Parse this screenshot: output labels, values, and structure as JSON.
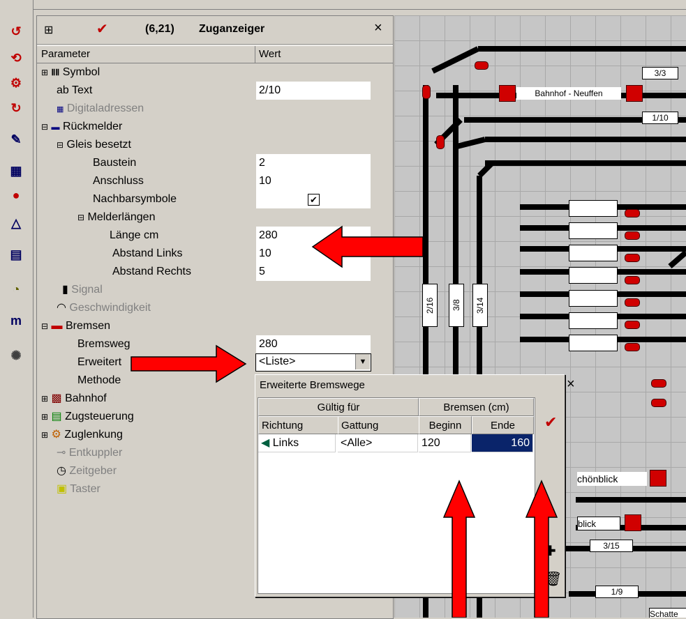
{
  "panel": {
    "coord": "(6,21)",
    "title": "Zuganzeiger",
    "close": "×",
    "col_param": "Parameter",
    "col_value": "Wert",
    "rows": [
      {
        "label": "Symbol"
      },
      {
        "label": "Text",
        "prefix": "ab",
        "value": "2/10"
      },
      {
        "label": "Digitaladressen"
      },
      {
        "label": "Rückmelder"
      },
      {
        "label": "Gleis besetzt"
      },
      {
        "label": "Baustein",
        "value": "2"
      },
      {
        "label": "Anschluss",
        "value": "10"
      },
      {
        "label": "Nachbarsymbole",
        "checked": true
      },
      {
        "label": "Melderlängen"
      },
      {
        "label": "Länge cm",
        "value": "280"
      },
      {
        "label": "Abstand Links",
        "value": "10"
      },
      {
        "label": "Abstand Rechts",
        "value": "5"
      },
      {
        "label": "Signal"
      },
      {
        "label": "Geschwindigkeit"
      },
      {
        "label": "Bremsen"
      },
      {
        "label": "Bremsweg",
        "value": "280"
      },
      {
        "label": "Erweitert",
        "value": "<Liste>"
      },
      {
        "label": "Methode"
      },
      {
        "label": "Bahnhof"
      },
      {
        "label": "Zugsteuerung"
      },
      {
        "label": "Zuglenkung"
      },
      {
        "label": "Entkuppler"
      },
      {
        "label": "Zeitgeber"
      },
      {
        "label": "Taster"
      }
    ]
  },
  "dialog": {
    "title": "Erweiterte Bremswege",
    "close": "×",
    "group1": "Gültig für",
    "group2": "Bremsen (cm)",
    "col_richtung": "Richtung",
    "col_gattung": "Gattung",
    "col_beginn": "Beginn",
    "col_ende": "Ende",
    "row": {
      "richtung": "Links",
      "gattung": "<Alle>",
      "beginn": "120",
      "ende": "160"
    }
  },
  "track": {
    "labels": [
      "3/3",
      "Bahnhof - Neuffen",
      "1/10",
      "2/16",
      "3/8",
      "3/14",
      "chönblick",
      "blick",
      "3/15",
      "1/9",
      "Schatte"
    ]
  },
  "colors": {
    "arrow": "#ff0000",
    "selection": "#0a246a",
    "signal": "#d00000"
  }
}
